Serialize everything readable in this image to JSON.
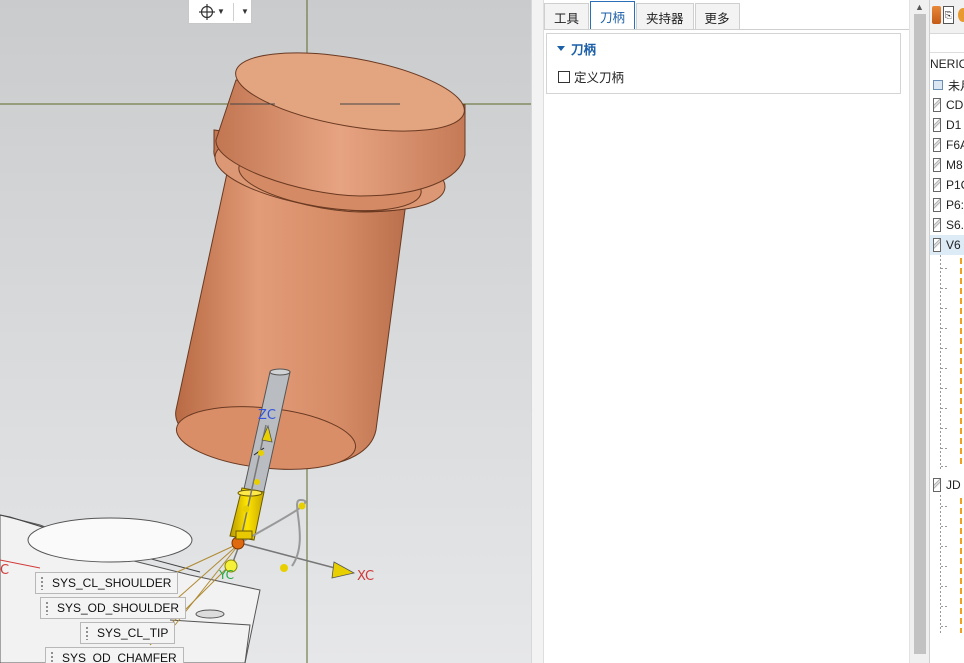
{
  "viewport": {
    "toolbar": {
      "snap_icon": "crosshair-target-icon",
      "dropdown_icon": "chevron-down-icon"
    },
    "axis_labels": {
      "zc": "ZC",
      "xc": "XC",
      "yc": "YC",
      "c": "C"
    },
    "geometry_labels": [
      "SYS_CL_SHOULDER",
      "SYS_OD_SHOULDER",
      "SYS_CL_TIP",
      "SYS_OD_CHAMFER"
    ]
  },
  "panel": {
    "tabs": [
      "工具",
      "刀柄",
      "夹持器",
      "更多"
    ],
    "active_tab": "刀柄",
    "group": {
      "title": "刀柄",
      "checkbox_label": "定义刀柄",
      "checked": false
    }
  },
  "navigator": {
    "header": "NERIC",
    "items": [
      {
        "label": "未月",
        "type": "folder"
      },
      {
        "label": "CD",
        "type": "tool"
      },
      {
        "label": "D1",
        "type": "tool"
      },
      {
        "label": "F6A",
        "type": "tool"
      },
      {
        "label": "M8",
        "type": "tool"
      },
      {
        "label": "P1C",
        "type": "tool"
      },
      {
        "label": "P6:",
        "type": "tool"
      },
      {
        "label": "S6.",
        "type": "tool"
      },
      {
        "label": "V6",
        "type": "tool",
        "selected": true
      }
    ],
    "lower_item": {
      "label": "JD",
      "type": "tool"
    }
  },
  "colors": {
    "accent": "#1b5fa8",
    "copper": "#d9906a",
    "tool_yellow": "#e8c800",
    "xc_red": "#d23a3a",
    "zc_blue": "#3355dd"
  }
}
